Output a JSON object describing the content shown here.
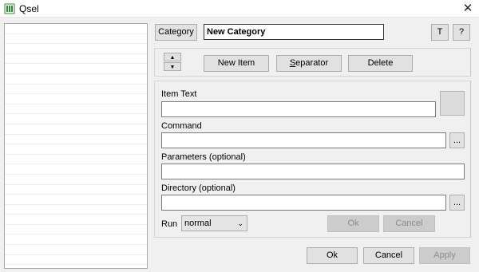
{
  "window": {
    "title": "Qsel",
    "close_glyph": "✕"
  },
  "header": {
    "category_button": "Category",
    "category_value": "New Category",
    "t_button": "T",
    "help_button": "?"
  },
  "toolbar": {
    "up_glyph": "▲",
    "down_glyph": "▼",
    "new_item": "New Item",
    "separator_pre": "",
    "separator_mnemonic": "S",
    "separator_post": "eparator",
    "delete": "Delete"
  },
  "form": {
    "item_text_label": "Item Text",
    "item_text_value": "",
    "command_label": "Command",
    "command_value": "",
    "browse_glyph": "...",
    "parameters_label": "Parameters (optional)",
    "parameters_value": "",
    "directory_label": "Directory (optional)",
    "directory_value": "",
    "run_label": "Run",
    "run_value": "normal",
    "run_chevron": "⌄",
    "ok": "Ok",
    "cancel": "Cancel"
  },
  "footer": {
    "ok": "Ok",
    "cancel": "Cancel",
    "apply": "Apply"
  }
}
